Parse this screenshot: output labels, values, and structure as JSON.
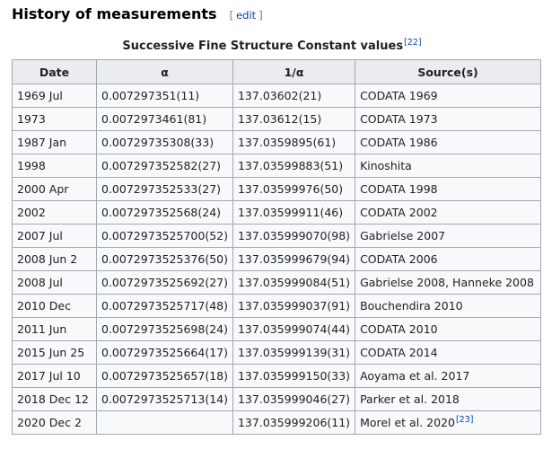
{
  "section": {
    "title": "History of measurements",
    "edit_open": "[",
    "edit_label": "edit",
    "edit_close": "]"
  },
  "caption": {
    "text": "Successive Fine Structure Constant values",
    "ref": "[22]"
  },
  "table": {
    "headers": [
      "Date",
      "α",
      "1/α",
      "Source(s)"
    ],
    "rows": [
      {
        "date": "1969 Jul",
        "alpha": "0.007297351(11)",
        "inverse": "137.03602(21)",
        "source": "CODATA 1969",
        "ref": ""
      },
      {
        "date": "1973",
        "alpha": "0.0072973461(81)",
        "inverse": "137.03612(15)",
        "source": "CODATA 1973",
        "ref": ""
      },
      {
        "date": "1987 Jan",
        "alpha": "0.00729735308(33)",
        "inverse": "137.0359895(61)",
        "source": "CODATA 1986",
        "ref": ""
      },
      {
        "date": "1998",
        "alpha": "0.007297352582(27)",
        "inverse": "137.03599883(51)",
        "source": "Kinoshita",
        "ref": ""
      },
      {
        "date": "2000 Apr",
        "alpha": "0.007297352533(27)",
        "inverse": "137.03599976(50)",
        "source": "CODATA 1998",
        "ref": ""
      },
      {
        "date": "2002",
        "alpha": "0.007297352568(24)",
        "inverse": "137.03599911(46)",
        "source": "CODATA 2002",
        "ref": ""
      },
      {
        "date": "2007 Jul",
        "alpha": "0.0072973525700(52)",
        "inverse": "137.035999070(98)",
        "source": "Gabrielse 2007",
        "ref": ""
      },
      {
        "date": "2008 Jun 2",
        "alpha": "0.0072973525376(50)",
        "inverse": "137.035999679(94)",
        "source": "CODATA 2006",
        "ref": ""
      },
      {
        "date": "2008 Jul",
        "alpha": "0.0072973525692(27)",
        "inverse": "137.035999084(51)",
        "source": "Gabrielse 2008, Hanneke 2008",
        "ref": ""
      },
      {
        "date": "2010 Dec",
        "alpha": "0.0072973525717(48)",
        "inverse": "137.035999037(91)",
        "source": "Bouchendira 2010",
        "ref": ""
      },
      {
        "date": "2011 Jun",
        "alpha": "0.0072973525698(24)",
        "inverse": "137.035999074(44)",
        "source": "CODATA 2010",
        "ref": ""
      },
      {
        "date": "2015 Jun 25",
        "alpha": "0.0072973525664(17)",
        "inverse": "137.035999139(31)",
        "source": "CODATA 2014",
        "ref": ""
      },
      {
        "date": "2017 Jul 10",
        "alpha": "0.0072973525657(18)",
        "inverse": "137.035999150(33)",
        "source": "Aoyama et al. 2017",
        "ref": ""
      },
      {
        "date": "2018 Dec 12",
        "alpha": "0.0072973525713(14)",
        "inverse": "137.035999046(27)",
        "source": "Parker et al. 2018",
        "ref": ""
      },
      {
        "date": "2020 Dec 2",
        "alpha": "",
        "inverse": "137.035999206(11)",
        "source": "Morel et al. 2020",
        "ref": "[23]"
      }
    ]
  }
}
